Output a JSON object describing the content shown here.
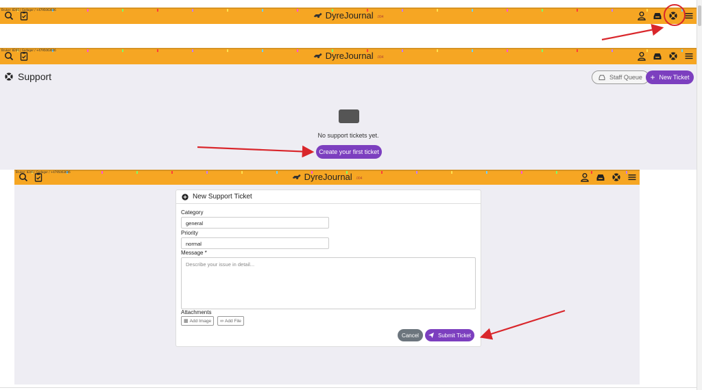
{
  "navbar": {
    "brand_name": "DyreJournal",
    "brand_sub": ".004",
    "tiny_text": "Bruker: 8246 | Godager / +4795063606"
  },
  "support": {
    "title": "Support",
    "staff_queue_label": "Staff Queue",
    "new_ticket_label": "New Ticket",
    "empty_text": "No support tickets yet.",
    "create_first_label": "Create your first ticket"
  },
  "form": {
    "header": "New Support Ticket",
    "category_label": "Category",
    "category_value": "general",
    "priority_label": "Priority",
    "priority_value": "normal",
    "message_label": "Message *",
    "message_placeholder": "Describe your issue in detail...",
    "attachments_label": "Attachments",
    "add_image_label": "Add Image",
    "add_file_label": "Add File",
    "cancel_label": "Cancel",
    "submit_label": "Submit Ticket"
  },
  "colors": {
    "navbar": "#f6a623",
    "accent": "#7c3fbf",
    "annotation": "#d9262b"
  },
  "icons": {
    "left": [
      "search-icon",
      "clipboard-icon"
    ],
    "right": [
      "user-icon",
      "inbox-icon",
      "lifebuoy-icon",
      "menu-icon"
    ]
  }
}
